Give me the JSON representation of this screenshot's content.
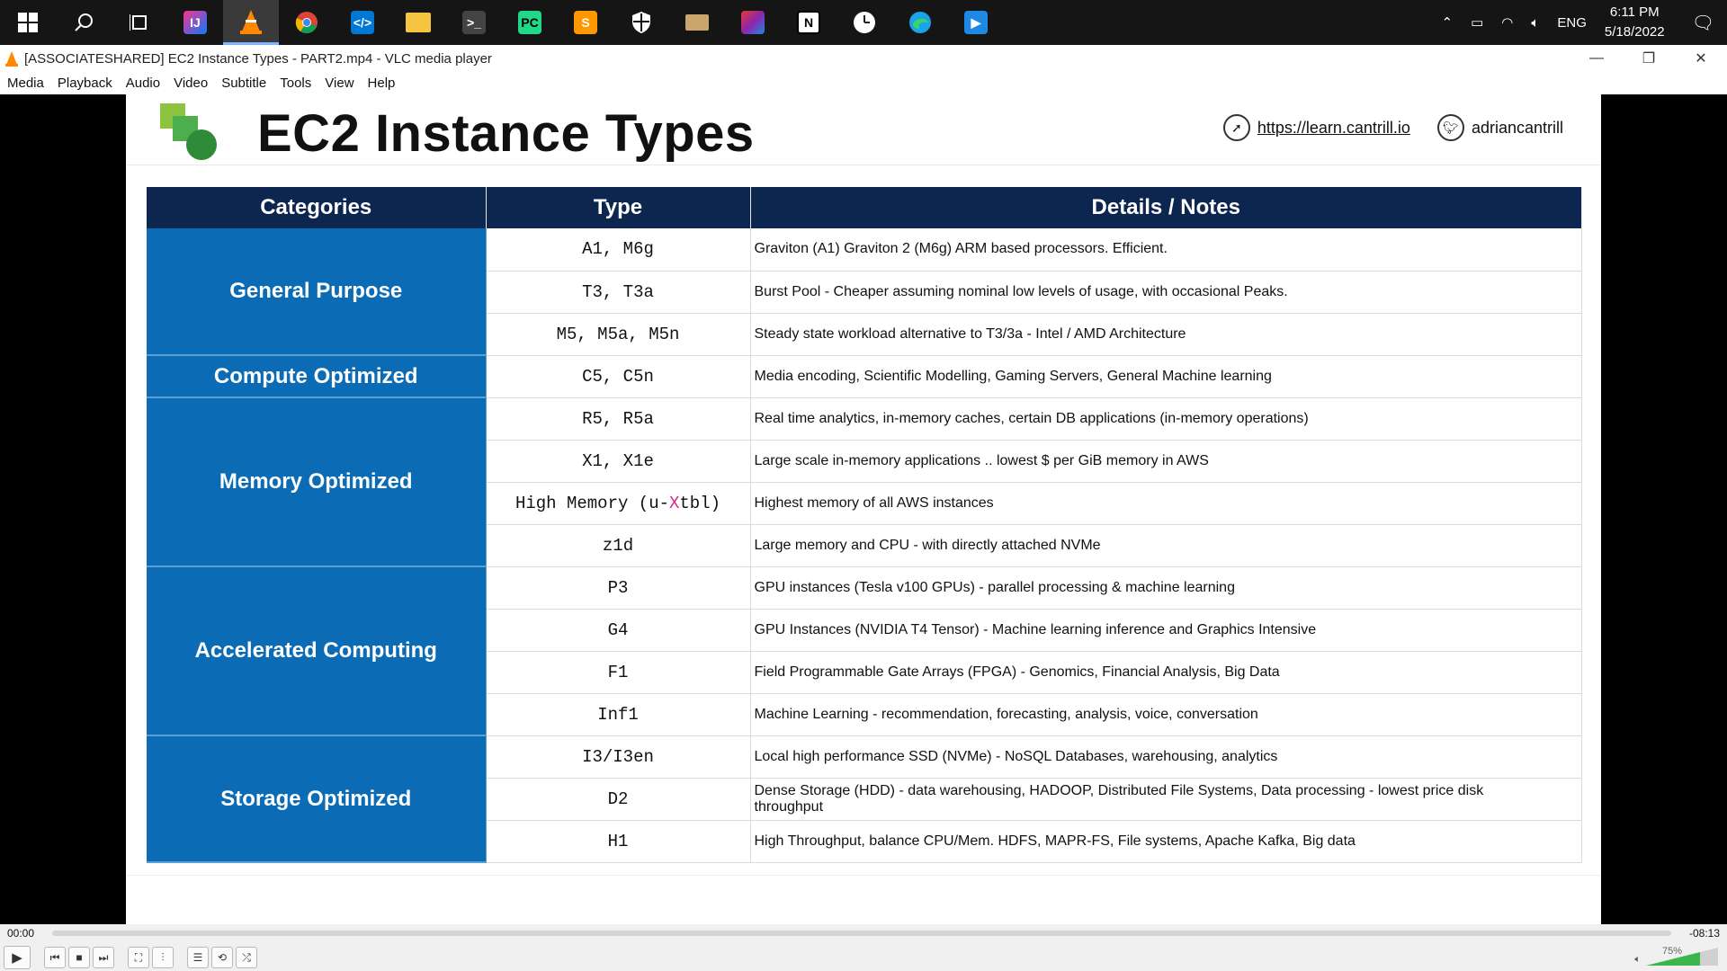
{
  "taskbar": {
    "items": [
      "windows-start",
      "search",
      "task-view",
      "intellij",
      "vlc",
      "chrome",
      "vscode",
      "file-explorer",
      "terminal",
      "pycharm",
      "sublime",
      "security",
      "app",
      "app2",
      "notion",
      "clock-app",
      "edge",
      "media-app"
    ],
    "tray": {
      "lang": "ENG",
      "time": "6:11 PM",
      "date": "5/18/2022"
    }
  },
  "window": {
    "title": "[ASSOCIATESHARED] EC2 Instance Types - PART2.mp4 - VLC media player"
  },
  "menu": [
    "Media",
    "Playback",
    "Audio",
    "Video",
    "Subtitle",
    "Tools",
    "View",
    "Help"
  ],
  "slide": {
    "title": "EC2 Instance Types",
    "link": "https://learn.cantrill.io",
    "handle": "adriancantrill",
    "headers": [
      "Categories",
      "Type",
      "Details / Notes"
    ],
    "categories": {
      "general": "General Purpose",
      "compute": "Compute Optimized",
      "memory": "Memory Optimized",
      "accel": "Accelerated Computing",
      "storage": "Storage Optimized"
    },
    "rows": [
      {
        "type": "A1, M6g",
        "details": "Graviton (A1) Graviton 2 (M6g) ARM based processors. Efficient."
      },
      {
        "type": "T3, T3a",
        "details": "Burst Pool - Cheaper assuming nominal low levels of usage, with occasional Peaks."
      },
      {
        "type": "M5, M5a, M5n",
        "details": "Steady state workload alternative to T3/3a - Intel / AMD Architecture"
      },
      {
        "type": "C5, C5n",
        "details": "Media encoding, Scientific Modelling, Gaming Servers, General Machine learning"
      },
      {
        "type": "R5, R5a",
        "details": "Real time analytics, in-memory caches, certain DB applications (in-memory operations)"
      },
      {
        "type": "X1, X1e",
        "details": "Large scale in-memory applications .. lowest $ per GiB memory in AWS"
      },
      {
        "type_pre": "High Memory (u-",
        "type_x": "X",
        "type_post": "tbl)",
        "details": "Highest memory of all AWS instances"
      },
      {
        "type": "z1d",
        "details": "Large memory and CPU - with directly attached NVMe"
      },
      {
        "type": "P3",
        "details": "GPU instances (Tesla v100 GPUs) - parallel processing & machine learning"
      },
      {
        "type": "G4",
        "details": "GPU Instances (NVIDIA T4 Tensor) - Machine learning inference and Graphics Intensive"
      },
      {
        "type": "F1",
        "details": "Field Programmable Gate Arrays (FPGA) - Genomics, Financial Analysis, Big Data"
      },
      {
        "type": "Inf1",
        "details": "Machine Learning - recommendation, forecasting, analysis, voice, conversation"
      },
      {
        "type": "I3/I3en",
        "details": "Local high performance SSD (NVMe) - NoSQL Databases, warehousing, analytics"
      },
      {
        "type": "D2",
        "details": "Dense Storage (HDD) - data warehousing, HADOOP, Distributed File Systems, Data processing - lowest price disk throughput"
      },
      {
        "type": "H1",
        "details": "High Throughput, balance CPU/Mem. HDFS, MAPR-FS, File systems, Apache Kafka, Big data"
      }
    ]
  },
  "player": {
    "elapsed": "00:00",
    "remaining": "-08:13",
    "volume": "75%"
  },
  "colors": {
    "header": "#0c2650",
    "category": "#0b6cb5",
    "accent": "#e0288c"
  }
}
